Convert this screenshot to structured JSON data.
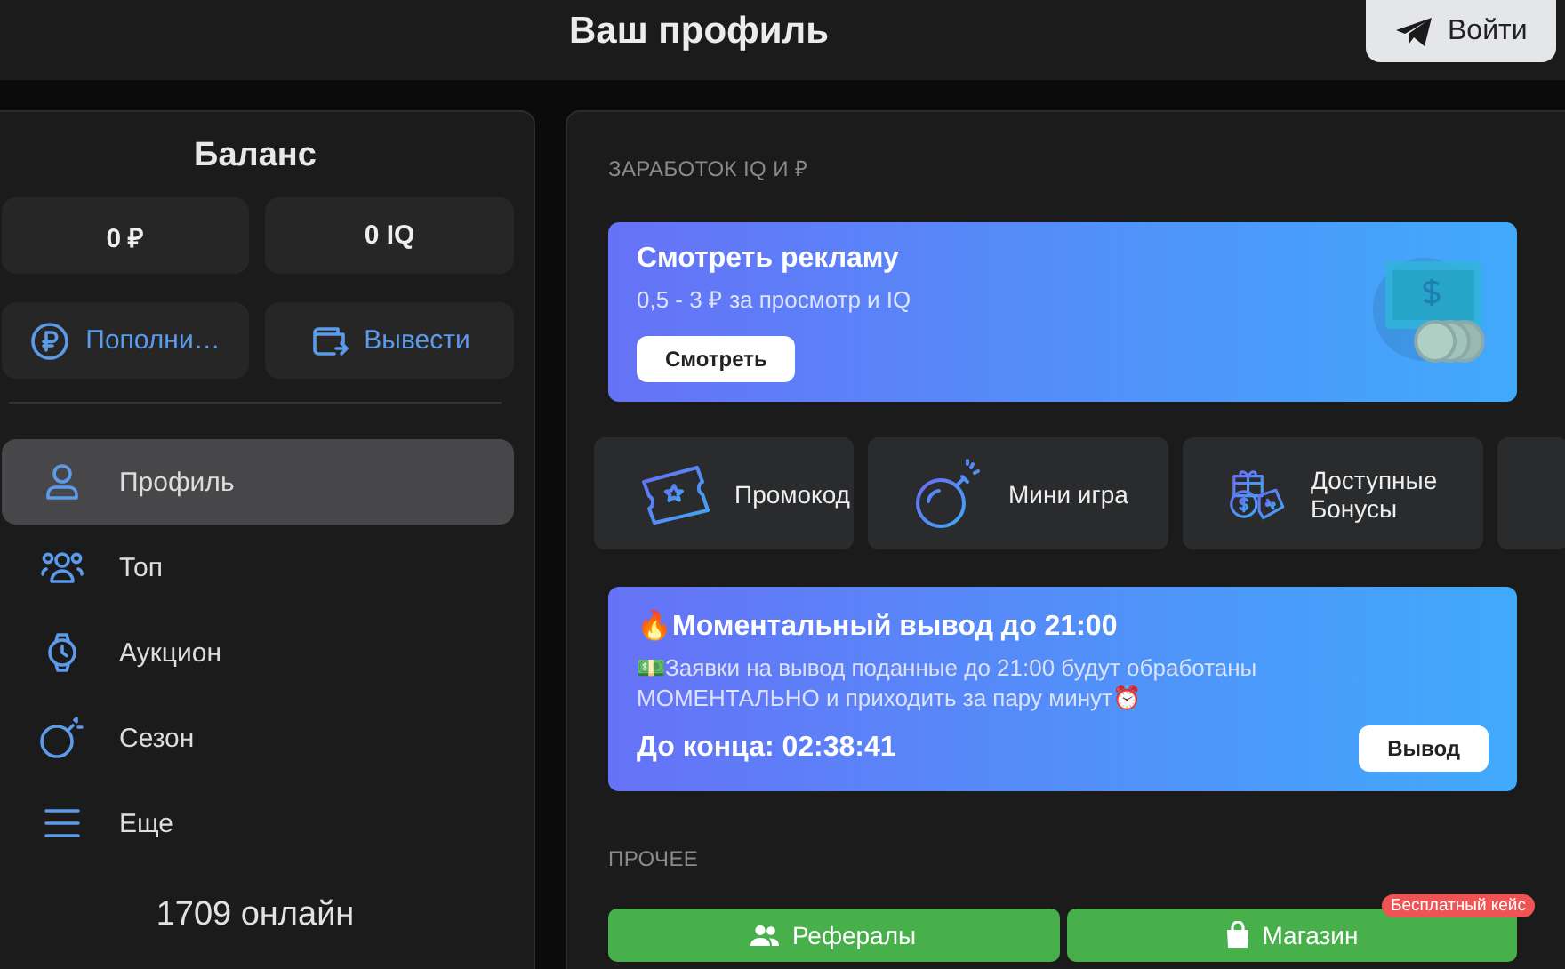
{
  "header": {
    "title": "Ваш профиль",
    "login_button": "Войти"
  },
  "sidebar": {
    "title": "Баланс",
    "balances": [
      "0 ₽",
      "0 IQ"
    ],
    "actions": [
      {
        "kind": "deposit",
        "label": "Пополни…"
      },
      {
        "kind": "withdraw",
        "label": "Вывести"
      }
    ],
    "nav": [
      {
        "kind": "profile",
        "label": "Профиль",
        "selected": true
      },
      {
        "kind": "top",
        "label": "Топ",
        "selected": false
      },
      {
        "kind": "auction",
        "label": "Аукцион",
        "selected": false
      },
      {
        "kind": "season",
        "label": "Сезон",
        "selected": false
      },
      {
        "kind": "more",
        "label": "Еще",
        "selected": false
      }
    ],
    "online": "1709 онлайн"
  },
  "main": {
    "earn_heading": "ЗАРАБОТОК IQ И ₽",
    "ad_card": {
      "title": "Смотреть рекламу",
      "subtitle": "0,5 - 3 ₽ за просмотр и IQ",
      "button": "Смотреть"
    },
    "tiles": [
      {
        "kind": "promo",
        "label": "Промокод"
      },
      {
        "kind": "game",
        "label": "Мини игра"
      },
      {
        "kind": "bonus",
        "label": "Доступные Бонусы"
      }
    ],
    "promo": {
      "title": "🔥Моментальный вывод до 21:00",
      "text": "💵Заявки на вывод поданные до 21:00 будут обработаны МОМЕНТАЛЬНО и приходить за пару минут⏰",
      "countdown": "До конца: 02:38:41",
      "button": "Вывод"
    },
    "other_heading": "ПРОЧЕЕ",
    "other_buttons": [
      {
        "kind": "referrals",
        "label": "Рефералы"
      },
      {
        "kind": "shop",
        "label": "Магазин",
        "badge": "Бесплатный кейс"
      }
    ]
  }
}
